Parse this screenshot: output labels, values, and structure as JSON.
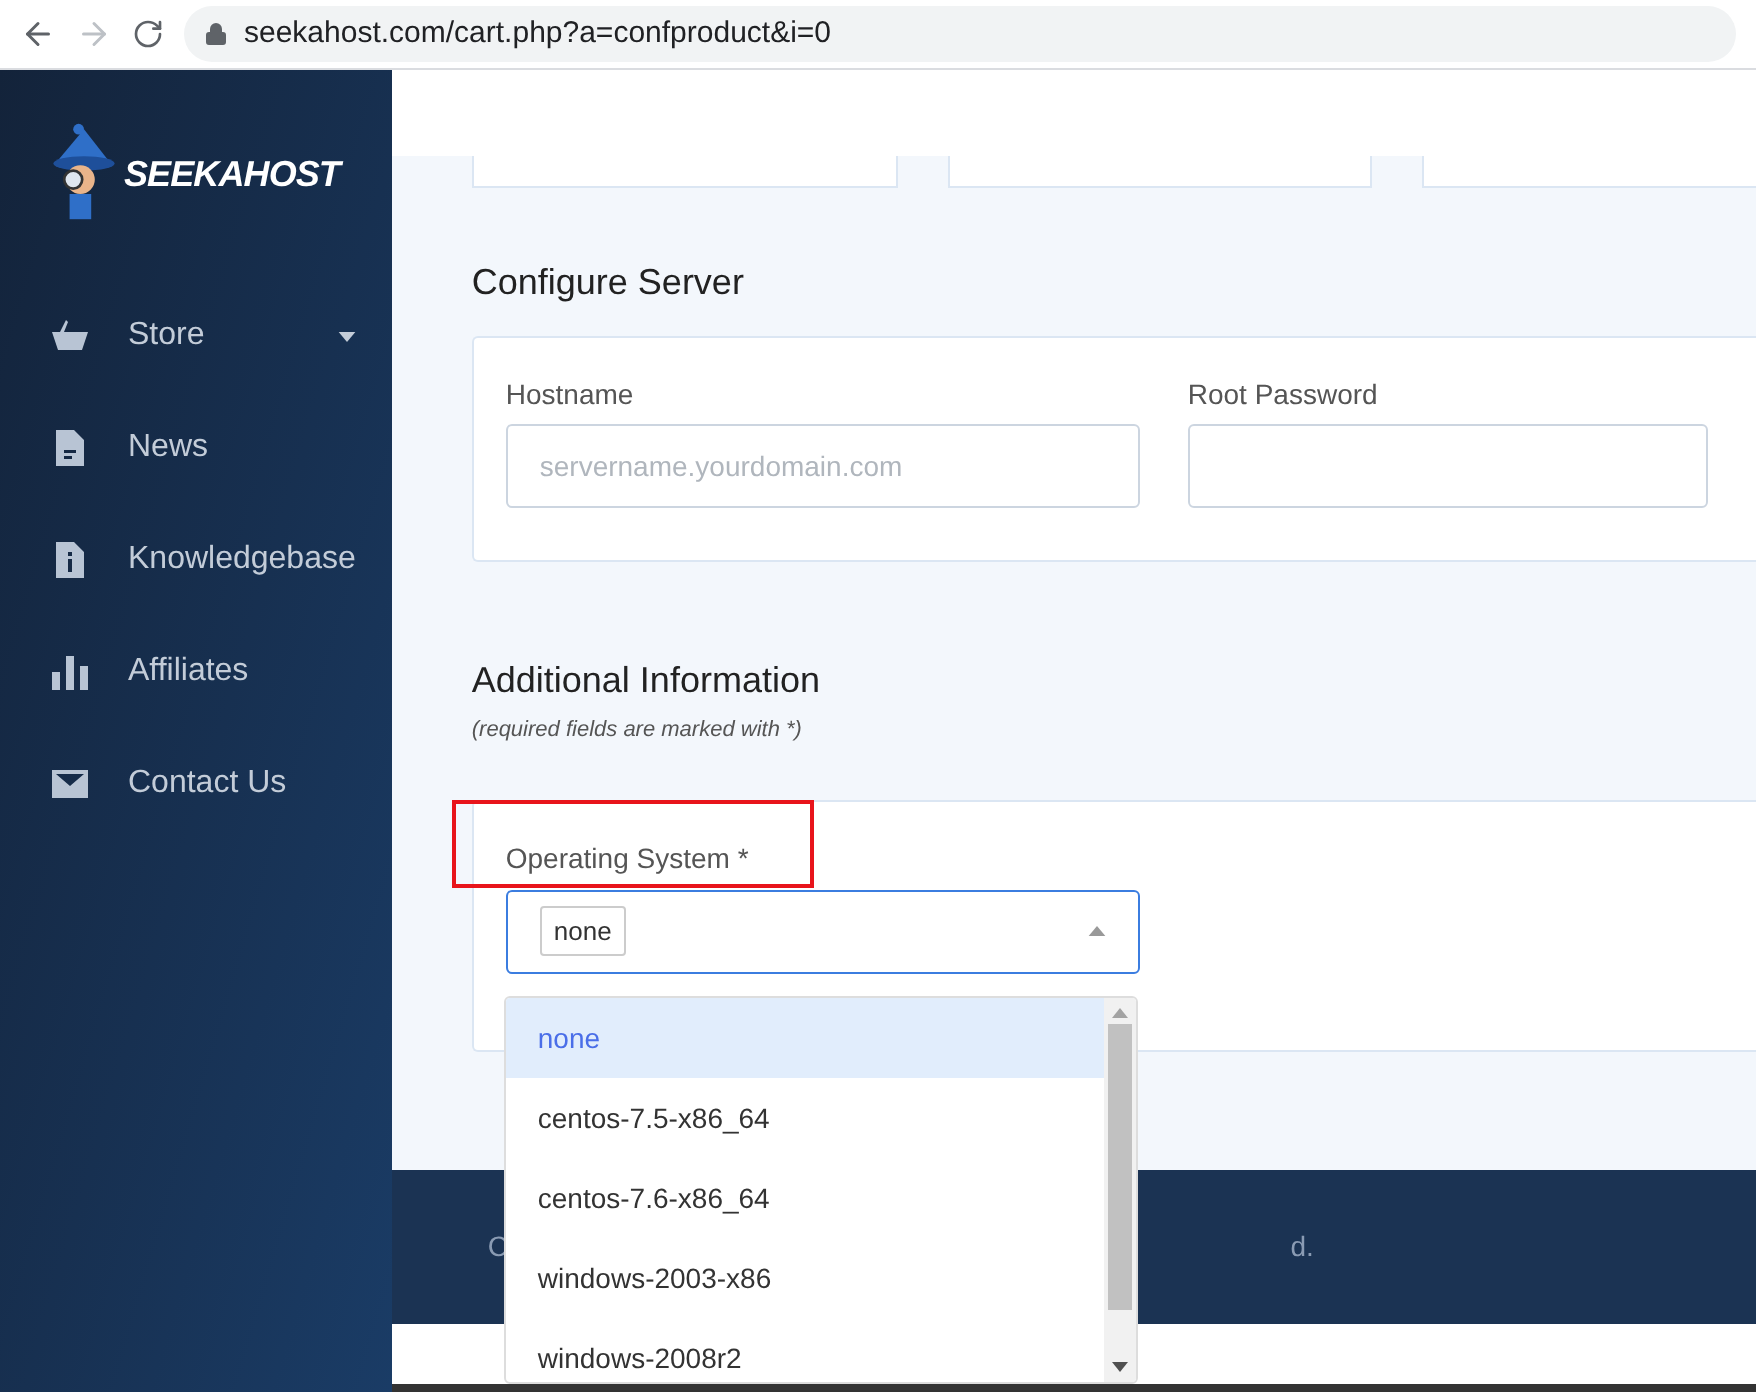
{
  "browser": {
    "url": "seekahost.com/cart.php?a=confproduct&i=0"
  },
  "sidebar": {
    "logo_text": "SEEKAHOST",
    "items": [
      {
        "label": "Store",
        "kind": "store",
        "has_caret": true
      },
      {
        "label": "News",
        "kind": "news",
        "has_caret": false
      },
      {
        "label": "Knowledgebase",
        "kind": "info",
        "has_caret": false
      },
      {
        "label": "Affiliates",
        "kind": "chart",
        "has_caret": false
      },
      {
        "label": "Contact Us",
        "kind": "mail",
        "has_caret": false
      }
    ]
  },
  "configure": {
    "title": "Configure Server",
    "fields": [
      {
        "label": "Hostname",
        "placeholder": "servername.yourdomain.com"
      },
      {
        "label": "Root Password"
      }
    ]
  },
  "additional": {
    "title": "Additional Information",
    "note": "(required fields are marked with *)",
    "select": {
      "label": "Operating System *",
      "value": "none",
      "expanded": true,
      "options": [
        {
          "label": "none",
          "selected": true
        },
        {
          "label": "centos-7.5-x86_64",
          "selected": false
        },
        {
          "label": "centos-7.6-x86_64",
          "selected": false
        },
        {
          "label": "windows-2003-x86",
          "selected": false
        },
        {
          "label": "windows-2008r2",
          "selected": false
        }
      ]
    }
  },
  "footer": {
    "text_start": "C",
    "text_end": "d."
  }
}
